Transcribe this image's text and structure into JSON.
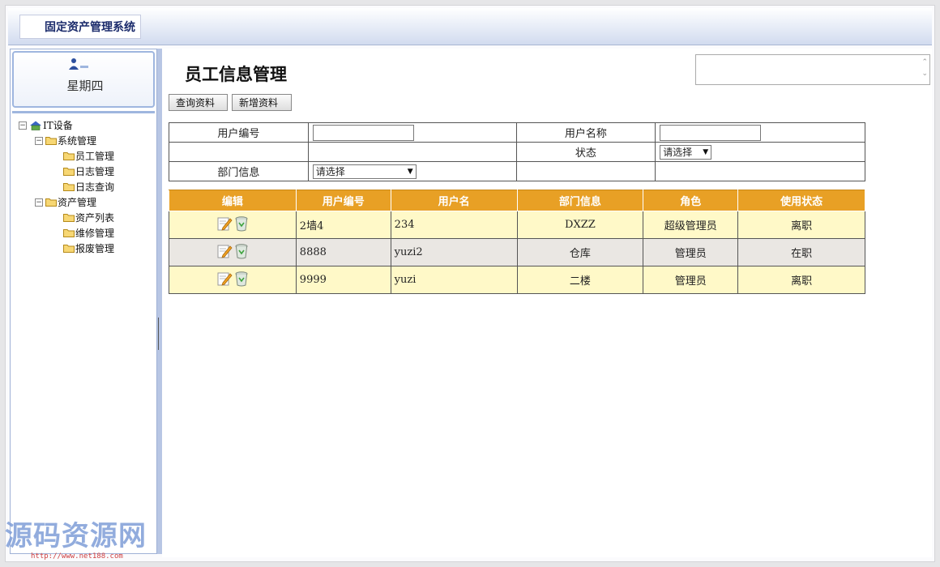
{
  "header": {
    "logo_text": "固定资产管理系统"
  },
  "sidebar": {
    "weekday": "星期四",
    "tree": [
      {
        "label": "IT设备",
        "level": 0,
        "toggle": "⊟",
        "kind": "home"
      },
      {
        "label": "系统管理",
        "level": 1,
        "toggle": "⊟",
        "kind": "folder"
      },
      {
        "label": "员工管理",
        "level": 2,
        "toggle": "",
        "kind": "folder"
      },
      {
        "label": "日志管理",
        "level": 2,
        "toggle": "",
        "kind": "folder"
      },
      {
        "label": "日志查询",
        "level": 2,
        "toggle": "",
        "kind": "folder"
      },
      {
        "label": "资产管理",
        "level": 1,
        "toggle": "⊟",
        "kind": "folder"
      },
      {
        "label": "资产列表",
        "level": 2,
        "toggle": "",
        "kind": "folder"
      },
      {
        "label": "维修管理",
        "level": 2,
        "toggle": "",
        "kind": "folder"
      },
      {
        "label": "报废管理",
        "level": 2,
        "toggle": "",
        "kind": "folder"
      }
    ]
  },
  "main": {
    "title": "员工信息管理",
    "buttons": {
      "query": "查询资料",
      "add": "新增资料"
    },
    "form": {
      "user_id_label": "用户编号",
      "user_name_label": "用户名称",
      "status_label": "状态",
      "status_value": "请选择",
      "dept_label": "部门信息",
      "dept_value": "请选择"
    },
    "table": {
      "headers": [
        "编辑",
        "用户编号",
        "用户名",
        "部门信息",
        "角色",
        "使用状态"
      ],
      "rows": [
        {
          "id": "2墙4",
          "name": "234",
          "dept": "DXZZ",
          "role": "超级管理员",
          "status": "离职"
        },
        {
          "id": "8888",
          "name": "yuzi2",
          "dept": "仓库",
          "role": "管理员",
          "status": "在职"
        },
        {
          "id": "9999",
          "name": "yuzi",
          "dept": "二楼",
          "role": "管理员",
          "status": "离职"
        }
      ]
    }
  },
  "watermark": {
    "text": "源码资源网",
    "url": "http://www.net188.com"
  },
  "colors": {
    "table_header": "#e8a025",
    "row_odd": "#fff9c8",
    "row_even": "#eae7e3",
    "sidebar_border": "#9fb1d6"
  }
}
